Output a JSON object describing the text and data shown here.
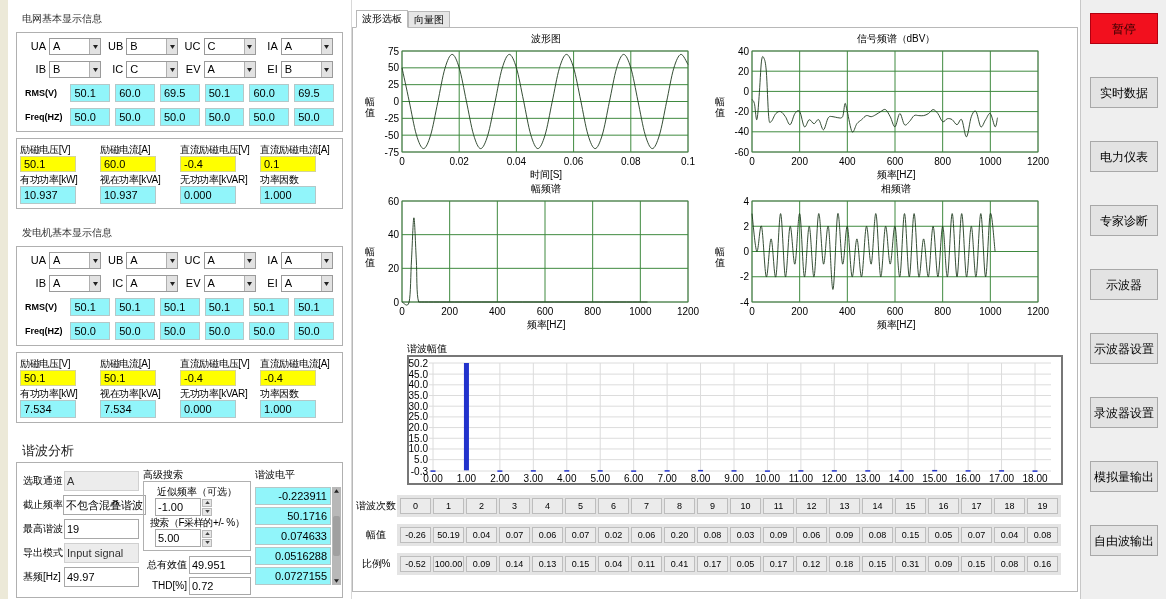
{
  "panels": [
    {
      "title": "电网基本显示信息",
      "selectors": [
        {
          "label": "UA",
          "value": "A"
        },
        {
          "label": "UB",
          "value": "B"
        },
        {
          "label": "UC",
          "value": "C"
        },
        {
          "label": "IA",
          "value": "A"
        },
        {
          "label": "IB",
          "value": "B"
        },
        {
          "label": "IC",
          "value": "C"
        },
        {
          "label": "EV",
          "value": "A"
        },
        {
          "label": "EI",
          "value": "B"
        }
      ],
      "rms_label": "RMS(V)",
      "rms": [
        "50.1",
        "60.0",
        "69.5",
        "50.1",
        "60.0",
        "69.5"
      ],
      "freq_label": "Freq(HZ)",
      "freq": [
        "50.0",
        "50.0",
        "50.0",
        "50.0",
        "50.0",
        "50.0"
      ],
      "excitation": [
        {
          "label": "励磁电压[V]",
          "value": "50.1"
        },
        {
          "label": "励磁电流[A]",
          "value": "60.0"
        },
        {
          "label": "直流励磁电压[V]",
          "value": "-0.4"
        },
        {
          "label": "直流励磁电流[A]",
          "value": "0.1"
        }
      ],
      "power": [
        {
          "label": "有功功率[kW]",
          "value": "10.937"
        },
        {
          "label": "视在功率[kVA]",
          "value": "10.937"
        },
        {
          "label": "无功功率[kVAR]",
          "value": "0.000"
        },
        {
          "label": "功率因数",
          "value": "1.000"
        }
      ]
    },
    {
      "title": "发电机基本显示信息",
      "selectors": [
        {
          "label": "UA",
          "value": "A"
        },
        {
          "label": "UB",
          "value": "A"
        },
        {
          "label": "UC",
          "value": "A"
        },
        {
          "label": "IA",
          "value": "A"
        },
        {
          "label": "IB",
          "value": "A"
        },
        {
          "label": "IC",
          "value": "A"
        },
        {
          "label": "EV",
          "value": "A"
        },
        {
          "label": "EI",
          "value": "A"
        }
      ],
      "rms_label": "RMS(V)",
      "rms": [
        "50.1",
        "50.1",
        "50.1",
        "50.1",
        "50.1",
        "50.1"
      ],
      "freq_label": "Freq(HZ)",
      "freq": [
        "50.0",
        "50.0",
        "50.0",
        "50.0",
        "50.0",
        "50.0"
      ],
      "excitation": [
        {
          "label": "励磁电压[V]",
          "value": "50.1"
        },
        {
          "label": "励磁电流[A]",
          "value": "50.1"
        },
        {
          "label": "直流励磁电压[V]",
          "value": "-0.4"
        },
        {
          "label": "直流励磁电流[A]",
          "value": "-0.4"
        }
      ],
      "power": [
        {
          "label": "有功功率[kW]",
          "value": "7.534"
        },
        {
          "label": "视在功率[kVA]",
          "value": "7.534"
        },
        {
          "label": "无功功率[kVAR]",
          "value": "0.000"
        },
        {
          "label": "功率因数",
          "value": "1.000"
        }
      ]
    }
  ],
  "harmonic_analysis": {
    "title": "谐波分析",
    "fields": [
      {
        "label": "选取通道",
        "value": "A",
        "disabled": true
      },
      {
        "label": "截止频率",
        "value": "不包含混叠谐波",
        "disabled": false
      },
      {
        "label": "最高谐波",
        "value": "19",
        "disabled": false
      },
      {
        "label": "导出模式",
        "value": "Input signal",
        "disabled": true
      },
      {
        "label": "基频[Hz]",
        "value": "49.97",
        "disabled": false
      }
    ],
    "advanced": {
      "title": "高级搜索",
      "approx_label": "近似频率（可选）",
      "approx_value": "-1.00",
      "search_label": "搜索（F采样的+/- %）",
      "search_value": "5.00"
    },
    "totals": [
      {
        "label": "总有效值",
        "value": "49.951"
      },
      {
        "label": "THD[%]",
        "value": "0.72"
      }
    ],
    "levels": {
      "title": "谐波电平",
      "values": [
        "-0.223911",
        "50.1716",
        "0.074633",
        "0.0516288",
        "0.0727155"
      ]
    }
  },
  "tabs": [
    {
      "label": "波形选板",
      "selected": true
    },
    {
      "label": "向量图",
      "selected": false
    }
  ],
  "charts": [
    {
      "chart_data": {
        "type": "line",
        "title": "波形图",
        "xlabel": "时间[S]",
        "ylabel": "幅值",
        "xlim": [
          0,
          0.1
        ],
        "ylim": [
          -75,
          75
        ],
        "xticks": [
          0,
          0.02,
          0.04,
          0.06,
          0.08,
          0.1
        ],
        "yticks": [
          -75,
          -50,
          -25,
          0,
          25,
          50,
          75
        ],
        "x": [
          0,
          0.0025,
          0.005,
          0.0075,
          0.01,
          0.0125,
          0.015,
          0.0175,
          0.02,
          0.0225,
          0.025,
          0.0275,
          0.03,
          0.0325,
          0.035,
          0.0375,
          0.04,
          0.0425,
          0.045,
          0.0475,
          0.05,
          0.0525,
          0.055,
          0.0575,
          0.06,
          0.0625,
          0.065,
          0.0675,
          0.07,
          0.0725,
          0.075,
          0.0775,
          0.08,
          0.0825,
          0.085,
          0.0875,
          0.09,
          0.0925,
          0.095,
          0.0975,
          0.1
        ],
        "grid": true,
        "series": [
          {
            "color": "#1e3a1e",
            "values": [
              50,
              1,
              -49,
              -70,
              -50,
              -1,
              49,
              70,
              50,
              1,
              -49,
              -70,
              -50,
              -1,
              49,
              70,
              50,
              1,
              -49,
              -70,
              -50,
              -1,
              49,
              70,
              50,
              1,
              -49,
              -70,
              -50,
              -1,
              49,
              70,
              50,
              1,
              -49,
              -70,
              -50,
              -1,
              49,
              70,
              55
            ]
          }
        ]
      }
    },
    {
      "chart_data": {
        "type": "line",
        "title": "信号频谱（dBV）",
        "xlabel": "频率[HZ]",
        "ylabel": "幅值",
        "xlim": [
          0,
          1200
        ],
        "ylim": [
          -60,
          40
        ],
        "xticks": [
          0,
          200,
          400,
          600,
          800,
          1000,
          1200
        ],
        "yticks": [
          -60,
          -40,
          -20,
          0,
          20,
          40
        ],
        "x": [
          0,
          10,
          20,
          30,
          40,
          50,
          60,
          70,
          80,
          100,
          120,
          140,
          160,
          180,
          200,
          220,
          240,
          260,
          280,
          300,
          320,
          340,
          360,
          380,
          390,
          400,
          420,
          440,
          460,
          480,
          500,
          520,
          540,
          560,
          580,
          600,
          620,
          640,
          660,
          680,
          700,
          720,
          740,
          760,
          780,
          800,
          820,
          840,
          860,
          880,
          900,
          920,
          940,
          960,
          980,
          1000,
          1020,
          1030
        ],
        "grid": true,
        "series": [
          {
            "color": "#1e3a1e",
            "values": [
              -8,
              -12,
              -28,
              -5,
              30,
              33,
              20,
              -25,
              -30,
              -22,
              -20,
              -25,
              -33,
              -22,
              -20,
              -35,
              -28,
              -32,
              -28,
              -38,
              -26,
              -25,
              -26,
              -25,
              -12,
              -20,
              -40,
              -32,
              -28,
              -24,
              -25,
              -23,
              -20,
              -18,
              -25,
              -35,
              -22,
              -33,
              -30,
              -24,
              -24,
              -24,
              -22,
              -18,
              -22,
              -30,
              -27,
              -28,
              -33,
              -28,
              -45,
              -25,
              -20,
              -35,
              -28,
              -22,
              -35,
              -26
            ]
          }
        ]
      }
    },
    {
      "chart_data": {
        "type": "line",
        "title": "幅频谱",
        "xlabel": "频率[HZ]",
        "ylabel": "幅值",
        "xlim": [
          0,
          1200
        ],
        "ylim": [
          0,
          60
        ],
        "xticks": [
          0,
          200,
          400,
          600,
          800,
          1000,
          1200
        ],
        "yticks": [
          0,
          20,
          40,
          60
        ],
        "x": [
          0,
          30,
          40,
          50,
          60,
          70,
          1030
        ],
        "grid": true,
        "series": [
          {
            "color": "#1e3a1e",
            "values": [
              0,
              0,
              25,
              50,
              25,
              0,
              0
            ]
          }
        ]
      }
    },
    {
      "chart_data": {
        "type": "line",
        "title": "相频谱",
        "xlabel": "频率[HZ]",
        "ylabel": "幅值",
        "xlim": [
          0,
          1200
        ],
        "ylim": [
          -4,
          4
        ],
        "xticks": [
          0,
          200,
          400,
          600,
          800,
          1000,
          1200
        ],
        "yticks": [
          -4,
          -2,
          0,
          2,
          4
        ],
        "x": [
          0,
          20,
          40,
          60,
          80,
          100,
          120,
          140,
          160,
          180,
          200,
          220,
          240,
          260,
          280,
          300,
          320,
          340,
          360,
          380,
          400,
          420,
          440,
          460,
          480,
          500,
          520,
          540,
          560,
          580,
          600,
          620,
          640,
          660,
          680,
          700,
          720,
          740,
          760,
          780,
          800,
          820,
          840,
          860,
          880,
          900,
          920,
          940,
          960,
          980,
          1000,
          1020
        ],
        "grid": true,
        "series": [
          {
            "color": "#1e3a1e",
            "values": [
              3,
              0,
              2,
              -2,
              1,
              -2,
              3,
              -2,
              2,
              -1,
              3,
              -2,
              2,
              -2,
              3,
              -1,
              2,
              -3,
              3,
              -1,
              2,
              -2,
              1,
              -2,
              2,
              -1,
              3,
              -2,
              2,
              -1,
              2,
              -2,
              3,
              -2,
              3,
              -2,
              1,
              -2,
              2,
              -2,
              2,
              -2,
              3,
              -2,
              3,
              -2,
              2,
              -2,
              3,
              -2,
              3,
              0
            ]
          }
        ]
      }
    }
  ],
  "harmonic_chart": {
    "chart_data": {
      "type": "bar",
      "title": "谐波幅值",
      "categories": [
        "0.00",
        "1.00",
        "2.00",
        "3.00",
        "4.00",
        "5.00",
        "6.00",
        "7.00",
        "8.00",
        "9.00",
        "10.00",
        "11.00",
        "12.00",
        "13.00",
        "14.00",
        "15.00",
        "16.00",
        "17.00",
        "18.00"
      ],
      "ylim": [
        -0.3,
        50.2
      ],
      "yticks": [
        {
          "value": -0.3,
          "label": "-0.3"
        },
        {
          "value": 5,
          "label": "5.0"
        },
        {
          "value": 10,
          "label": "10.0"
        },
        {
          "value": 15,
          "label": "15.0"
        },
        {
          "value": 20,
          "label": "20.0"
        },
        {
          "value": 25,
          "label": "25.0"
        },
        {
          "value": 30,
          "label": "30.0"
        },
        {
          "value": 35,
          "label": "35.0"
        },
        {
          "value": 40,
          "label": "40.0"
        },
        {
          "value": 45,
          "label": "45.0"
        },
        {
          "value": 50.2,
          "label": "50.2"
        }
      ],
      "grid": true,
      "series": [
        {
          "color": "#2233cc",
          "values": [
            -0.3,
            50.2,
            0,
            0.1,
            0.1,
            0.1,
            0,
            0.1,
            0.2,
            0.1,
            0,
            0.1,
            0.1,
            0.1,
            0.1,
            0.2,
            0.1,
            0.1,
            0
          ]
        }
      ]
    }
  },
  "harmonic_table": {
    "rows": [
      {
        "label": "谐波次数",
        "values": [
          "0",
          "1",
          "2",
          "3",
          "4",
          "5",
          "6",
          "7",
          "8",
          "9",
          "10",
          "11",
          "12",
          "13",
          "14",
          "15",
          "16",
          "17",
          "18",
          "19"
        ]
      },
      {
        "label": "幅值",
        "values": [
          "-0.26",
          "50.19",
          "0.04",
          "0.07",
          "0.06",
          "0.07",
          "0.02",
          "0.06",
          "0.20",
          "0.08",
          "0.03",
          "0.09",
          "0.06",
          "0.09",
          "0.08",
          "0.15",
          "0.05",
          "0.07",
          "0.04",
          "0.08"
        ]
      },
      {
        "label": "比例%",
        "values": [
          "-0.52",
          "100.00",
          "0.09",
          "0.14",
          "0.13",
          "0.15",
          "0.04",
          "0.11",
          "0.41",
          "0.17",
          "0.05",
          "0.17",
          "0.12",
          "0.18",
          "0.15",
          "0.31",
          "0.09",
          "0.15",
          "0.08",
          "0.16"
        ]
      }
    ]
  },
  "side_buttons": [
    {
      "label": "暂停",
      "active": true
    },
    {
      "label": "实时数据",
      "active": false
    },
    {
      "label": "电力仪表",
      "active": false
    },
    {
      "label": "专家诊断",
      "active": false
    },
    {
      "label": "示波器",
      "active": false
    },
    {
      "label": "示波器设置",
      "active": false
    },
    {
      "label": "录波器设置",
      "active": false
    },
    {
      "label": "模拟量输出",
      "active": false
    },
    {
      "label": "自由波输出",
      "active": false
    }
  ]
}
